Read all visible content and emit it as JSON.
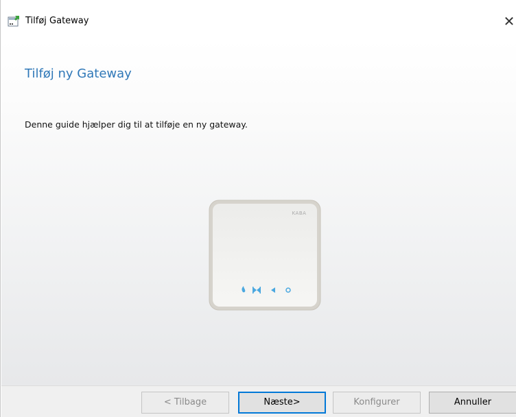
{
  "window": {
    "title": "Tilføj Gateway",
    "close_glyph": "✕"
  },
  "content": {
    "heading": "Tilføj ny Gateway",
    "description": "Denne guide hjælper dig til at tilføje en ny gateway.",
    "device_brand": "KABA",
    "device_icons": [
      "flame-icon",
      "bowtie-icon",
      "left-triangle-icon",
      "circle-icon"
    ]
  },
  "buttons": {
    "back": "< Tilbage",
    "next": "Næste>",
    "configure": "Konfigurer",
    "cancel": "Annuller"
  },
  "colors": {
    "heading": "#2f78b8",
    "device_led": "#4aa8e0",
    "default_button_border": "#0078d7"
  }
}
